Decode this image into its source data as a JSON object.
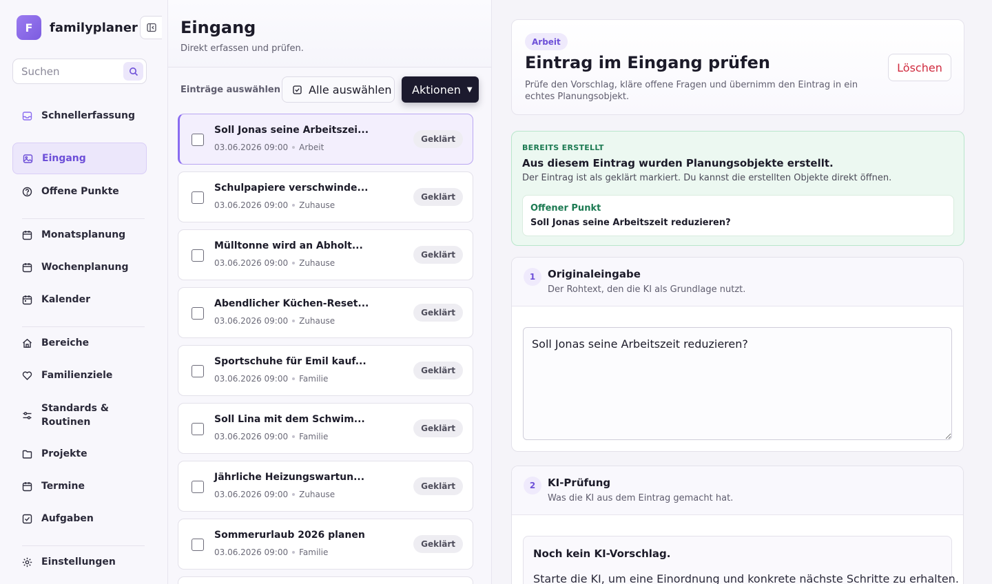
{
  "brand": {
    "logo_letter": "F",
    "name": "familyplaner"
  },
  "search": {
    "placeholder": "Suchen"
  },
  "sidebar": {
    "items": [
      {
        "label": "Schnellerfassung",
        "icon": "inbox-icon"
      },
      {
        "label": "Eingang",
        "icon": "image-icon",
        "active": true
      },
      {
        "label": "Offene Punkte",
        "icon": "question-circle-icon"
      },
      {
        "label": "Monatsplanung",
        "icon": "calendar-icon"
      },
      {
        "label": "Wochenplanung",
        "icon": "calendar-icon"
      },
      {
        "label": "Kalender",
        "icon": "calendar-icon"
      },
      {
        "label": "Bereiche",
        "icon": "home-icon"
      },
      {
        "label": "Familienziele",
        "icon": "heart-icon"
      },
      {
        "label": "Standards & Routinen",
        "icon": "sliders-icon"
      },
      {
        "label": "Projekte",
        "icon": "folder-icon"
      },
      {
        "label": "Termine",
        "icon": "calendar-icon"
      },
      {
        "label": "Aufgaben",
        "icon": "check-square-icon"
      },
      {
        "label": "Einstellungen",
        "icon": "gear-icon"
      }
    ]
  },
  "inbox": {
    "title": "Eingang",
    "subtitle": "Direkt erfassen und prüfen.",
    "select_label": "Einträge auswählen",
    "select_all_label": "Alle auswählen",
    "actions_label": "Aktionen",
    "entries": [
      {
        "title": "Soll Jonas seine Arbeitszei...",
        "date": "03.06.2026 09:00",
        "category": "Arbeit",
        "status": "Geklärt",
        "selected": true
      },
      {
        "title": "Schulpapiere verschwinde...",
        "date": "03.06.2026 09:00",
        "category": "Zuhause",
        "status": "Geklärt"
      },
      {
        "title": "Mülltonne wird an Abholt...",
        "date": "03.06.2026 09:00",
        "category": "Zuhause",
        "status": "Geklärt"
      },
      {
        "title": "Abendlicher Küchen-Reset...",
        "date": "03.06.2026 09:00",
        "category": "Zuhause",
        "status": "Geklärt"
      },
      {
        "title": "Sportschuhe für Emil kauf...",
        "date": "03.06.2026 09:00",
        "category": "Familie",
        "status": "Geklärt"
      },
      {
        "title": "Soll Lina mit dem Schwim...",
        "date": "03.06.2026 09:00",
        "category": "Familie",
        "status": "Geklärt"
      },
      {
        "title": "Jährliche Heizungswartun...",
        "date": "03.06.2026 09:00",
        "category": "Zuhause",
        "status": "Geklärt"
      },
      {
        "title": "Sommerurlaub 2026 planen",
        "date": "03.06.2026 09:00",
        "category": "Familie",
        "status": "Geklärt"
      }
    ]
  },
  "detail": {
    "tag": "Arbeit",
    "title": "Eintrag im Eingang prüfen",
    "description": "Prüfe den Vorschlag, kläre offene Fragen und übernimm den Eintrag in ein echtes Planungsobjekt.",
    "delete_label": "Löschen",
    "created": {
      "eyebrow": "BEREITS ERSTELLT",
      "title": "Aus diesem Eintrag wurden Planungsobjekte erstellt.",
      "description": "Der Eintrag ist als geklärt markiert. Du kannst die erstellten Objekte direkt öffnen.",
      "item_type": "Offener Punkt",
      "item_title": "Soll Jonas seine Arbeitszeit reduzieren?"
    },
    "step1": {
      "number": "1",
      "title": "Originaleingabe",
      "subtitle": "Der Rohtext, den die KI als Grundlage nutzt.",
      "text": "Soll Jonas seine Arbeitszeit reduzieren?"
    },
    "step2": {
      "number": "2",
      "title": "KI-Prüfung",
      "subtitle": "Was die KI aus dem Eintrag gemacht hat.",
      "empty_title": "Noch kein KI-Vorschlag.",
      "empty_desc": "Starte die KI, um eine Einordnung und konkrete nächste Schritte zu erhalten."
    }
  },
  "colors": {
    "accent": "#7c5ce0",
    "success_bg": "#ecf8f1",
    "danger": "#d02a3e"
  }
}
